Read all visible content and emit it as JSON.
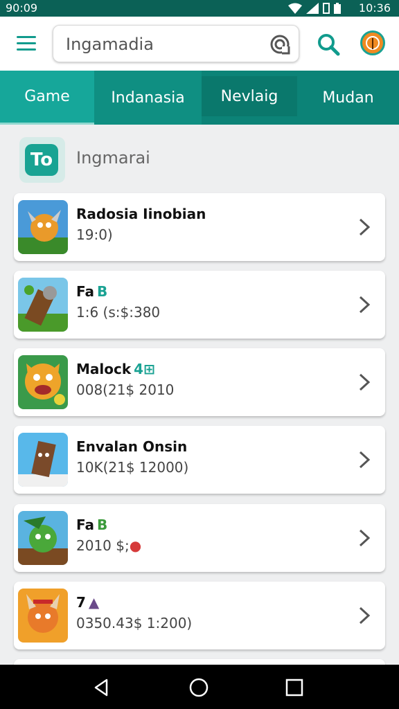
{
  "status_bar": {
    "time_left": "90:09",
    "time_right": "10:36"
  },
  "search": {
    "value": "Ingamadia"
  },
  "tabs": [
    {
      "label": "Game"
    },
    {
      "label": "Indanasia"
    },
    {
      "label": "Nevlaig"
    },
    {
      "label": "Mudan"
    }
  ],
  "category": {
    "title": "Ingmarai",
    "icon_glyph": "To"
  },
  "games": [
    {
      "name": "Radosia Iinobian",
      "badge": "",
      "badge_color": "",
      "meta": "19:0)",
      "meta_badge": "",
      "meta_badge_color": ""
    },
    {
      "name": "Fa",
      "badge": "B",
      "badge_color": "#1aa293",
      "meta": "1:6 (s:$:380",
      "meta_badge": "",
      "meta_badge_color": ""
    },
    {
      "name": "Malock",
      "badge": "4⊞",
      "badge_color": "#1aa293",
      "meta": "008(21$ 2010",
      "meta_badge": "",
      "meta_badge_color": ""
    },
    {
      "name": "Envalan Onsin",
      "badge": "",
      "badge_color": "",
      "meta": "10K(21$ 12000)",
      "meta_badge": "",
      "meta_badge_color": ""
    },
    {
      "name": "Fa",
      "badge": "B",
      "badge_color": "#3a9a3a",
      "meta": "2010 $;",
      "meta_badge": "●",
      "meta_badge_color": "#d63a3a"
    },
    {
      "name": "7",
      "badge": "▲",
      "badge_color": "#6a4a8a",
      "meta": "0350.43$ 1:200)",
      "meta_badge": "",
      "meta_badge_color": ""
    }
  ],
  "colors": {
    "accent": "#119b8d",
    "tab_bar": "#0c8377",
    "status_bar": "#0b6156"
  },
  "icons": [
    "menu-icon",
    "scan-icon",
    "search-icon",
    "avatar",
    "chevron-right-icon",
    "back-icon",
    "home-icon",
    "recents-icon"
  ]
}
